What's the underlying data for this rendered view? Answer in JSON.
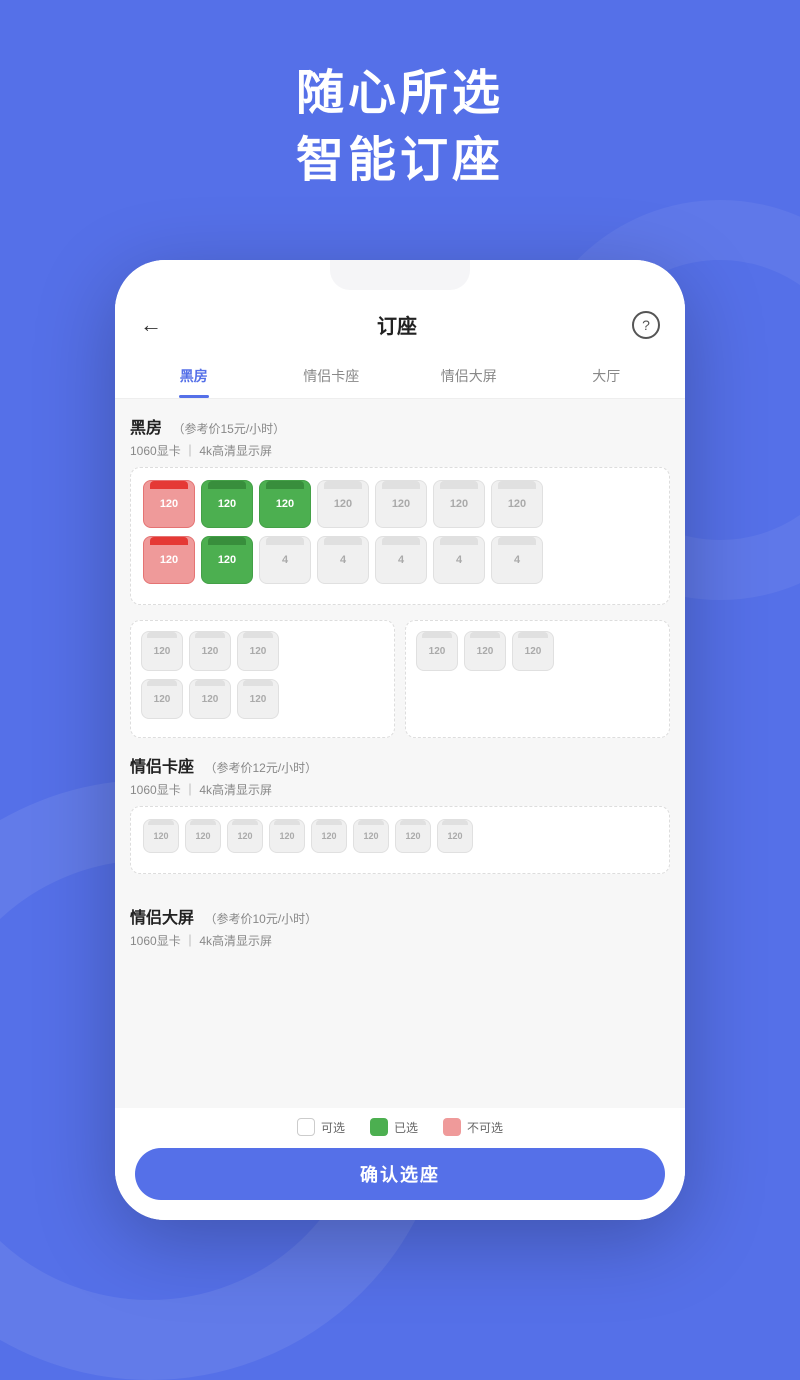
{
  "hero": {
    "line1": "随心所选",
    "line2": "智能订座"
  },
  "nav": {
    "back_icon": "←",
    "title": "订座",
    "help_icon": "?"
  },
  "tabs": [
    {
      "label": "黑房",
      "active": true
    },
    {
      "label": "情侣卡座",
      "active": false
    },
    {
      "label": "情侣大屏",
      "active": false
    },
    {
      "label": "大厅",
      "active": false
    }
  ],
  "sections": [
    {
      "id": "hei-fang",
      "title": "黑房",
      "price": "（参考价15元/小时）",
      "spec": "1060显卡  |  4k高清显示屏",
      "rows": [
        [
          {
            "type": "occupied",
            "label": "120"
          },
          {
            "type": "selected",
            "label": "120"
          },
          {
            "type": "selected",
            "label": "120"
          },
          {
            "type": "available",
            "label": "120"
          },
          {
            "type": "available",
            "label": "120"
          },
          {
            "type": "available",
            "label": "120"
          },
          {
            "type": "available",
            "label": "120"
          }
        ],
        [
          {
            "type": "occupied",
            "label": "120"
          },
          {
            "type": "selected",
            "label": "120"
          },
          {
            "type": "available",
            "label": "4"
          },
          {
            "type": "available",
            "label": "4"
          },
          {
            "type": "available",
            "label": "4"
          },
          {
            "type": "available",
            "label": "4"
          },
          {
            "type": "available",
            "label": "4"
          }
        ]
      ],
      "two_col": [
        {
          "rows": [
            [
              {
                "type": "available",
                "label": "120"
              },
              {
                "type": "available",
                "label": "120"
              },
              {
                "type": "available",
                "label": "120"
              }
            ],
            [
              {
                "type": "available",
                "label": "120"
              },
              {
                "type": "available",
                "label": "120"
              },
              {
                "type": "available",
                "label": "120"
              }
            ]
          ]
        },
        {
          "rows": [
            [
              {
                "type": "available",
                "label": "120"
              },
              {
                "type": "available",
                "label": "120"
              },
              {
                "type": "available",
                "label": "120"
              }
            ]
          ]
        }
      ]
    },
    {
      "id": "qinlv-kazuo",
      "title": "情侣卡座",
      "price": "（参考价12元/小时）",
      "spec": "1060显卡  |  4k高清显示屏",
      "rows": [
        [
          {
            "type": "available",
            "label": "120"
          },
          {
            "type": "available",
            "label": "120"
          },
          {
            "type": "available",
            "label": "120"
          },
          {
            "type": "available",
            "label": "120"
          },
          {
            "type": "available",
            "label": "120"
          },
          {
            "type": "available",
            "label": "120"
          },
          {
            "type": "available",
            "label": "120"
          },
          {
            "type": "available",
            "label": "120"
          }
        ]
      ]
    },
    {
      "id": "qinlv-daping",
      "title": "情侣大屏",
      "price": "（参考价10元/小时）",
      "spec": "1060显卡  |  4k高清显示屏"
    }
  ],
  "legend": {
    "available_label": "可选",
    "selected_label": "已选",
    "occupied_label": "不可选"
  },
  "confirm_button": "确认选座"
}
